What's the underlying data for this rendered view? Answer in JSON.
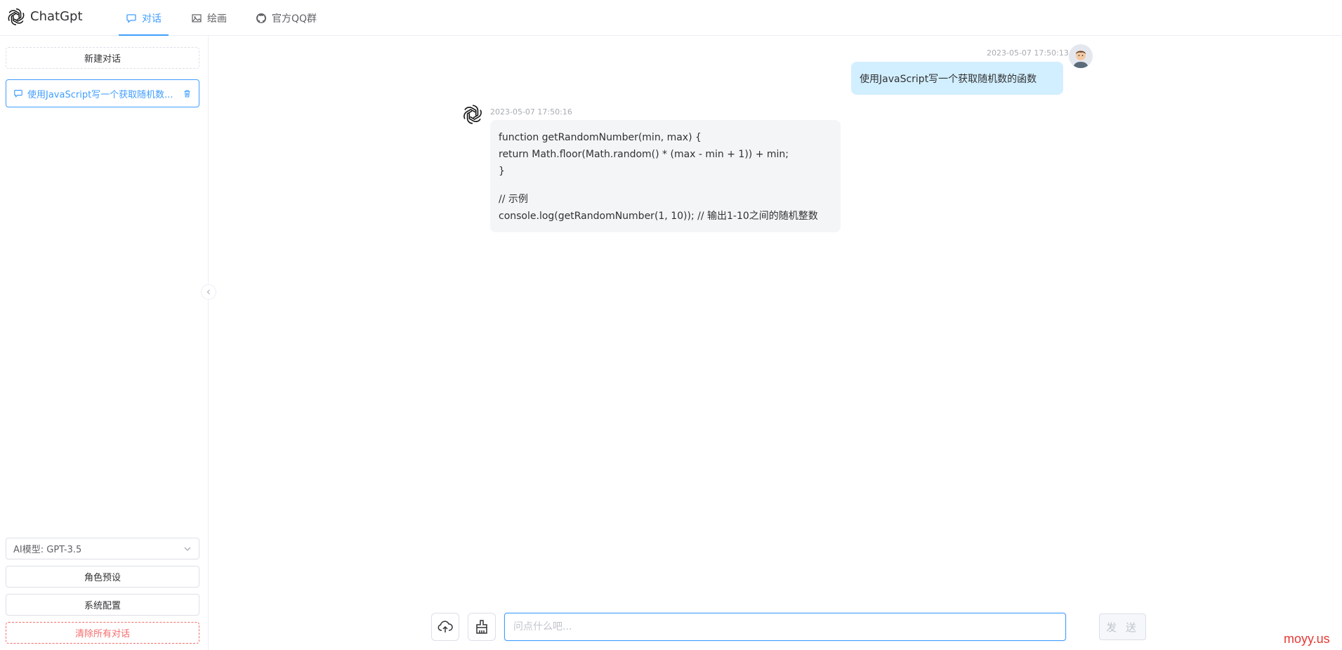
{
  "app": {
    "title": "ChatGpt"
  },
  "nav": {
    "tabs": [
      {
        "label": "对话",
        "icon": "chat-bubble-icon",
        "active": true
      },
      {
        "label": "绘画",
        "icon": "image-icon",
        "active": false
      },
      {
        "label": "官方QQ群",
        "icon": "github-icon",
        "active": false
      }
    ]
  },
  "sidebar": {
    "new_chat_label": "新建对话",
    "conversations": [
      {
        "title": "使用JavaScript写一个获取随机数...",
        "active": true
      }
    ],
    "model_select": {
      "value": "AI模型: GPT-3.5"
    },
    "role_preset_label": "角色预设",
    "system_config_label": "系统配置",
    "clear_all_label": "清除所有对话"
  },
  "chat": {
    "messages": [
      {
        "role": "user",
        "time": "2023-05-07 17:50:13",
        "text": "使用JavaScript写一个获取随机数的函数"
      },
      {
        "role": "assistant",
        "time": "2023-05-07 17:50:16",
        "lines": [
          "function getRandomNumber(min, max) {",
          "return Math.floor(Math.random() * (max - min + 1)) + min;",
          "}",
          "// 示例",
          "console.log(getRandomNumber(1, 10)); // 输出1-10之间的随机整数"
        ]
      }
    ]
  },
  "input": {
    "placeholder": "问点什么吧...",
    "value": "",
    "send_label": "发 送"
  },
  "watermark": "moyy.us",
  "colors": {
    "accent": "#409eff",
    "danger": "#f56c6c",
    "user_bubble": "#d2efff",
    "bot_bubble": "#f4f5f7"
  }
}
